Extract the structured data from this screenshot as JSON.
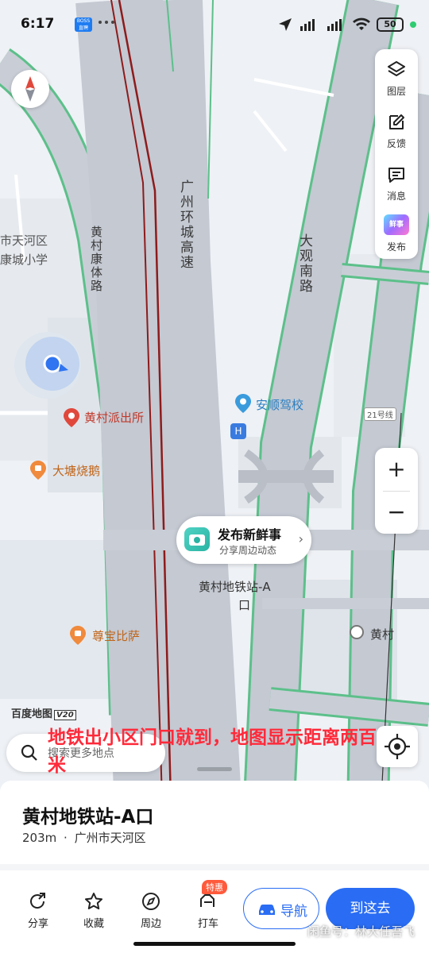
{
  "status_bar": {
    "time": "6:17",
    "app_badge": "BOSS直聘",
    "battery": "50"
  },
  "map": {
    "roads": {
      "ring_expressway": "广州环城高速",
      "daguan_road": "大观南路",
      "huangcun_kangti_road": "黄村康体路",
      "line_21": "21号线"
    },
    "area_labels": {
      "district": "市天河区",
      "school": "康城小学"
    },
    "pois": {
      "police": "黄村派出所",
      "bbq_goose": "大塘烧鹅",
      "driving_school": "安顺驾校",
      "pizza": "尊宝比萨",
      "metro_exit": "黄村地铁站-A",
      "metro_exit_2": "口",
      "huangcun_station": "黄村"
    },
    "logo": "百度地图",
    "logo_version": "V20"
  },
  "tools": {
    "layers": "图层",
    "feedback": "反馈",
    "messages": "消息",
    "publish": "发布",
    "publish_badge": "鲜事"
  },
  "zoom": {
    "in": "+",
    "out": "−"
  },
  "bubble": {
    "title": "发布新鲜事",
    "subtitle": "分享周边动态"
  },
  "search": {
    "placeholder": "搜索更多地点"
  },
  "caption": "地铁出小区门口就到，地图显示距离两百米",
  "sheet": {
    "place_name": "黄村地铁站-A口",
    "distance": "203m",
    "separator": "·",
    "district": "广州市天河区"
  },
  "actions": {
    "share": "分享",
    "favorite": "收藏",
    "nearby": "周边",
    "taxi": "打车",
    "taxi_tag": "特惠",
    "navigate": "导航",
    "go_here": "到这去"
  },
  "watermark": "闲鱼号：林大任吾飞",
  "colors": {
    "accent": "#2a6df4",
    "caption_red": "#ff2a3a",
    "road_outline": "#5cc08a",
    "map_bg": "#eef1f5"
  }
}
